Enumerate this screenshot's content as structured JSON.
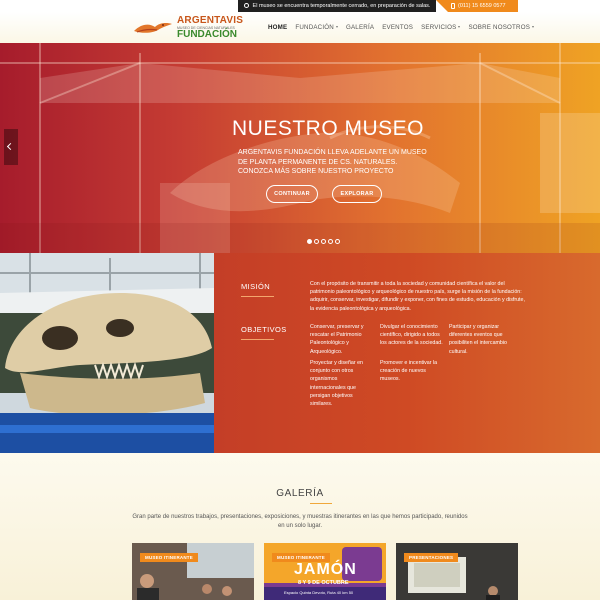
{
  "topbar": {
    "notice": "El museo se encuentra temporalmente cerrado, en preparación de salas.",
    "phone": "(011) 15 6559 0577"
  },
  "logo": {
    "line1": "ARGENTAVIS",
    "line2": "MUSEO DE CIENCIAS NATURALES",
    "line3": "FUNDACIÓN"
  },
  "nav": {
    "items": [
      {
        "label": "HOME",
        "active": true,
        "dropdown": false
      },
      {
        "label": "FUNDACIÓN",
        "active": false,
        "dropdown": true
      },
      {
        "label": "GALERÍA",
        "active": false,
        "dropdown": false
      },
      {
        "label": "EVENTOS",
        "active": false,
        "dropdown": false
      },
      {
        "label": "SERVICIOS",
        "active": false,
        "dropdown": true
      },
      {
        "label": "SOBRE NOSOTROS",
        "active": false,
        "dropdown": true
      }
    ]
  },
  "hero": {
    "title": "NUESTRO MUSEO",
    "text": "ARGENTAVIS FUNDACIÓN LLEVA ADELANTE UN MUSEO DE PLANTA PERMANENTE DE CS. NATURALES. CONOZCA MÁS SOBRE NUESTRO PROYECTO",
    "button1": "CONTINUAR",
    "button2": "EXPLORAR",
    "slides": 5,
    "active_slide": 1
  },
  "mission": {
    "label1": "MISIÓN",
    "text": "Con el propósito de transmitir a toda la sociedad y comunidad científica el valor del patrimonio paleontológico y arqueológico de nuestro país, surge la misión de la fundación: adquirir, conservar, investigar, difundir y exponer, con fines de estudio, educación y disfrute, la evidencia paleontológica y arqueológica.",
    "label2": "OBJETIVOS",
    "objectives": [
      "Conservar, preservar y rescatar el Patrimonio Paleontológico y Arqueológico.",
      "Divulgar el conocimiento científico, dirigido a todos los actores de la sociedad.",
      "Participar y organizar diferentes eventos que posibiliten el intercambio cultural.",
      "Proyectar y diseñar en conjunto con otros organismos internacionales que persigan objetivos similares.",
      "Promover e incentivar la creación de nuevos museos."
    ]
  },
  "gallery": {
    "title": "GALERÍA",
    "text": "Gran parte de nuestros trabajos, presentaciones, exposiciones, y muestras itinerantes en las que hemos participado, reunidos en un solo lugar.",
    "cards": [
      {
        "tag": "MUSEO ITINERANTE"
      },
      {
        "tag": "MUSEO ITINERANTE",
        "poster_big": "JAMÓN",
        "poster_date": "8 Y 9 DE OCTUBRE",
        "poster_place": "Espacio Quinta Devoto, Ruta 40 km 50"
      },
      {
        "tag": "PRESENTACIONES"
      }
    ]
  },
  "colors": {
    "accent": "#f08a1c",
    "hero_left": "#a61c2c",
    "hero_right": "#efa324",
    "panel": "#c43e27"
  }
}
